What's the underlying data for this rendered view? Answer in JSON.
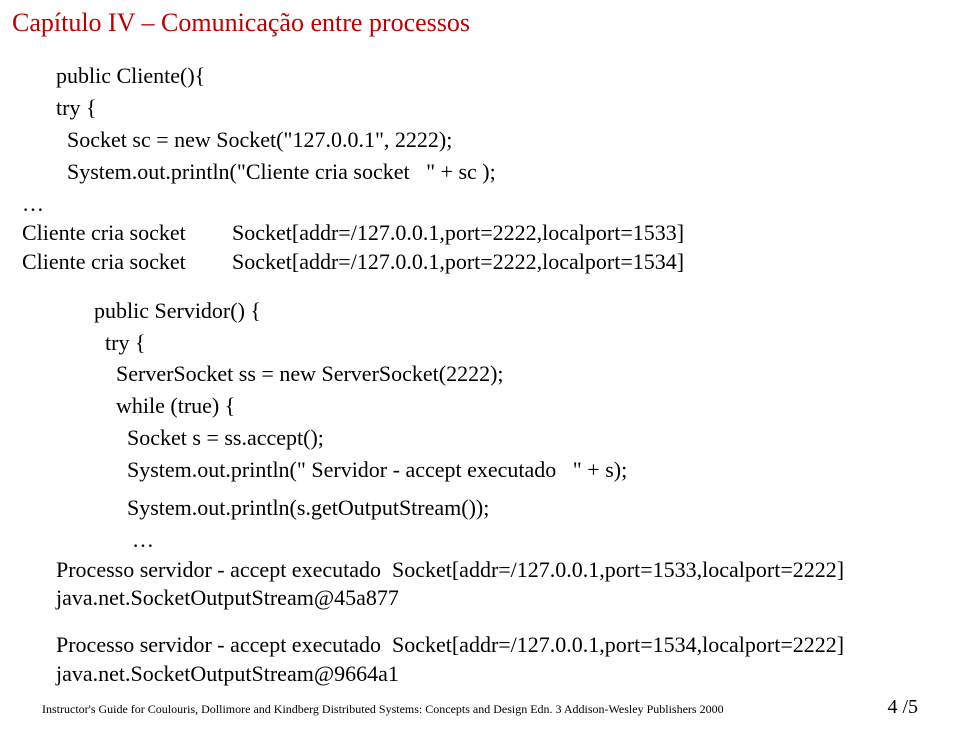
{
  "heading": "Capítulo IV – Comunicação entre processos",
  "code1": {
    "l1": "public Cliente(){",
    "l2": "try {",
    "l3": "  Socket sc = new Socket(\"127.0.0.1\", 2222);",
    "l4": "  System.out.println(\"Cliente cria socket   \" + sc );",
    "l5": "…"
  },
  "out1": {
    "r1a": "Cliente cria socket",
    "r1b": "Socket[addr=/127.0.0.1,port=2222,localport=1533]",
    "r2a": "Cliente cria socket",
    "r2b": "Socket[addr=/127.0.0.1,port=2222,localport=1534]"
  },
  "code2": {
    "l1": "public Servidor() {",
    "l2": "  try {",
    "l3": "    ServerSocket ss = new ServerSocket(2222);",
    "l4": "    while (true) {",
    "l5": "      Socket s = ss.accept();",
    "l6": "      System.out.println(\" Servidor - accept executado   \" + s);",
    "l7": "      System.out.println(s.getOutputStream());",
    "l8": "…"
  },
  "out2": {
    "l1": "Processo servidor - accept executado  Socket[addr=/127.0.0.1,port=1533,localport=2222]",
    "l2": "java.net.SocketOutputStream@45a877",
    "l3": "Processo servidor - accept executado  Socket[addr=/127.0.0.1,port=1534,localport=2222]",
    "l4": "java.net.SocketOutputStream@9664a1"
  },
  "footer": {
    "ref": "Instructor's Guide for Coulouris, Dollimore and Kindberg  Distributed Systems: Concepts and Design  Edn. 3  Addison-Wesley Publishers 2000",
    "page": "4 /5"
  }
}
